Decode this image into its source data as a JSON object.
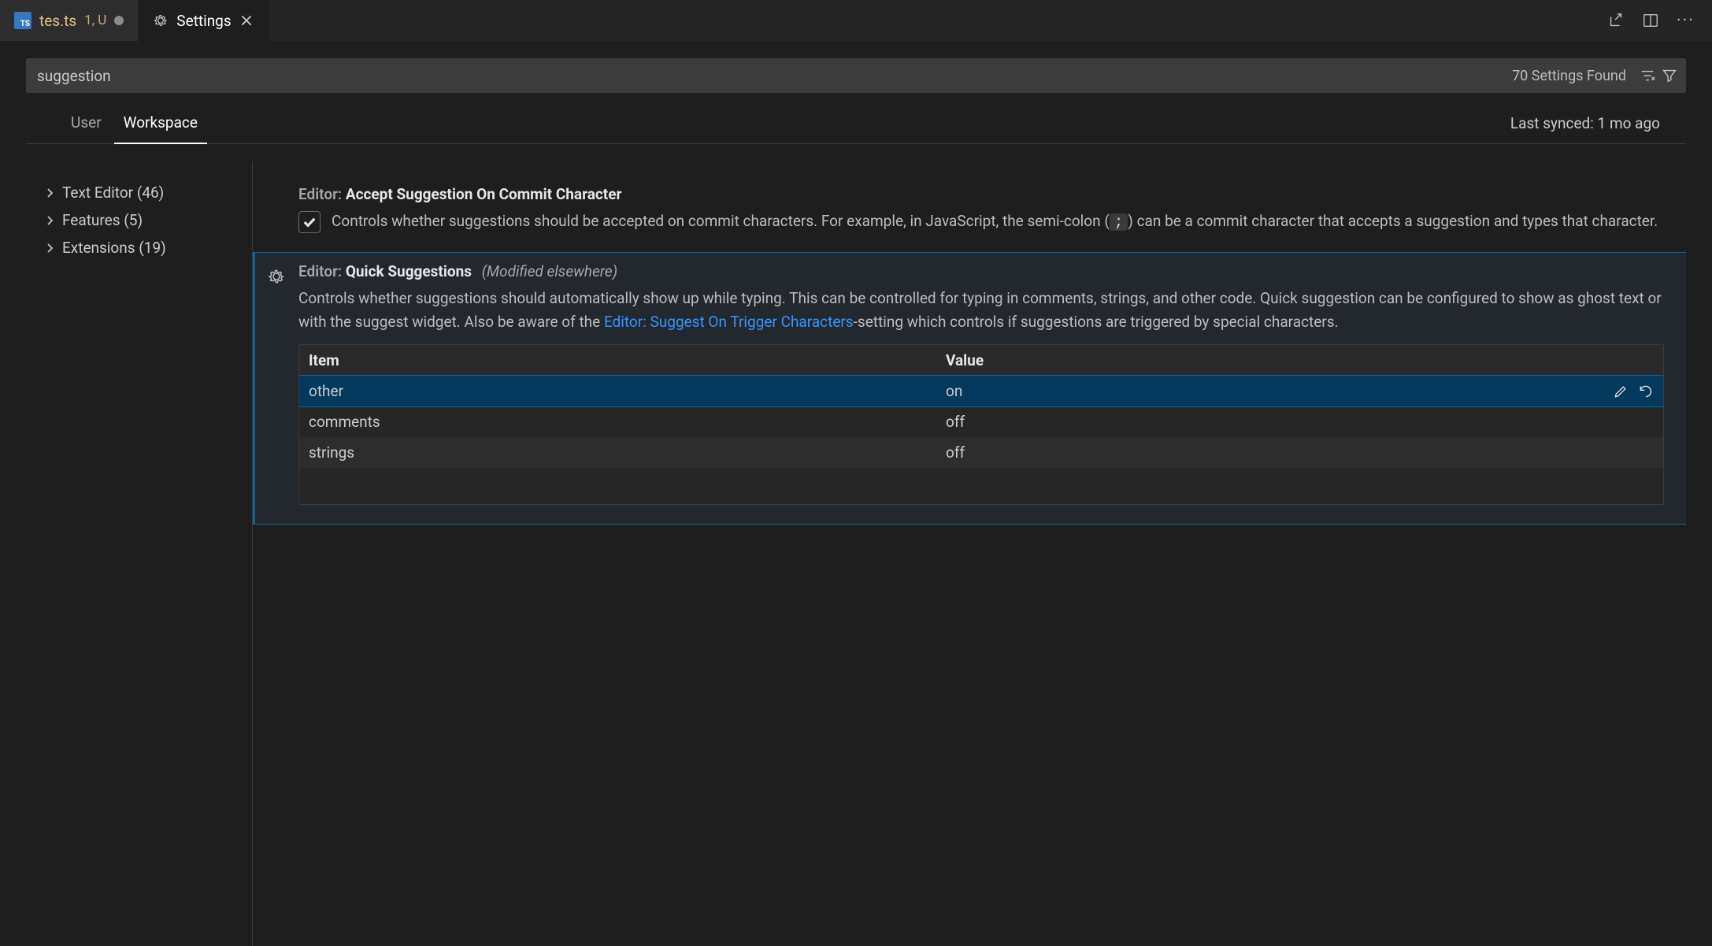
{
  "tabs": {
    "file": {
      "name": "tes.ts",
      "sub": "1, U"
    },
    "settings": "Settings"
  },
  "search": {
    "value": "suggestion",
    "count": "70 Settings Found"
  },
  "scope": {
    "user": "User",
    "workspace": "Workspace",
    "sync": "Last synced: 1 mo ago"
  },
  "tree": [
    {
      "label": "Text Editor (46)"
    },
    {
      "label": "Features (5)"
    },
    {
      "label": "Extensions (19)"
    }
  ],
  "settings": {
    "accept": {
      "scope": "Editor:",
      "name": "Accept Suggestion On Commit Character",
      "desc_a": "Controls whether suggestions should be accepted on commit characters. For example, in JavaScript, the semi-colon (",
      "desc_code": ";",
      "desc_b": ") can be a commit character that accepts a suggestion and types that character.",
      "checked": true
    },
    "quick": {
      "scope": "Editor:",
      "name": "Quick Suggestions",
      "note": "(Modified elsewhere)",
      "desc_a": "Controls whether suggestions should automatically show up while typing. This can be controlled for typing in comments, strings, and other code. Quick suggestion can be configured to show as ghost text or with the suggest widget. Also be aware of the ",
      "link": "Editor: Suggest On Trigger Characters",
      "desc_b": "-setting which controls if suggestions are triggered by special characters.",
      "table": {
        "head_item": "Item",
        "head_value": "Value",
        "rows": [
          {
            "item": "other",
            "value": "on",
            "selected": true
          },
          {
            "item": "comments",
            "value": "off",
            "selected": false
          },
          {
            "item": "strings",
            "value": "off",
            "selected": false
          }
        ]
      }
    }
  }
}
